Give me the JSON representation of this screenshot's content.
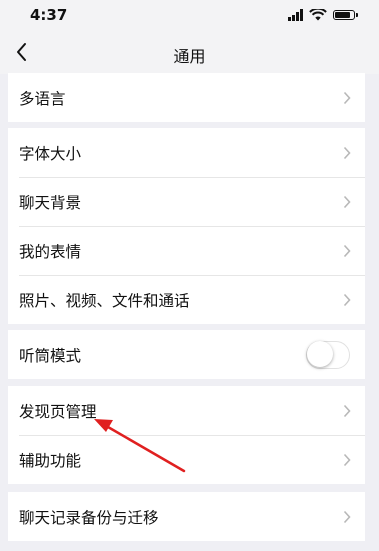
{
  "status_bar": {
    "time": "4:37",
    "signal_icon": "cellular-signal-icon",
    "wifi_icon": "wifi-icon",
    "battery_icon": "battery-icon",
    "battery_level": 0.9
  },
  "nav": {
    "back_icon": "chevron-left-icon",
    "title": "通用"
  },
  "groups": [
    {
      "rows": [
        {
          "label": "多语言",
          "accessory": "chevron"
        }
      ]
    },
    {
      "rows": [
        {
          "label": "字体大小",
          "accessory": "chevron"
        },
        {
          "label": "聊天背景",
          "accessory": "chevron"
        },
        {
          "label": "我的表情",
          "accessory": "chevron"
        },
        {
          "label": "照片、视频、文件和通话",
          "accessory": "chevron"
        }
      ]
    },
    {
      "rows": [
        {
          "label": "听筒模式",
          "accessory": "toggle",
          "toggle_on": false
        }
      ]
    },
    {
      "rows": [
        {
          "label": "发现页管理",
          "accessory": "chevron"
        },
        {
          "label": "辅助功能",
          "accessory": "chevron"
        }
      ]
    },
    {
      "rows": [
        {
          "label": "聊天记录备份与迁移",
          "accessory": "chevron"
        }
      ]
    }
  ],
  "annotation": {
    "arrow_icon": "red-arrow-icon",
    "arrow_color": "#e02020",
    "points_to": "发现页管理"
  },
  "colors": {
    "background": "#efeff4",
    "cell": "#ffffff",
    "separator": "#e6e6e6",
    "chevron": "#b8b8b8"
  }
}
